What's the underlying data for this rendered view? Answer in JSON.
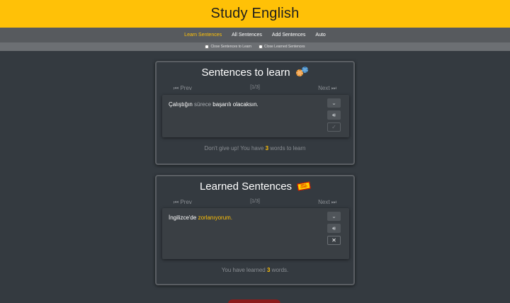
{
  "app": {
    "title": "Study English"
  },
  "nav": {
    "items": [
      {
        "label": "Learn Sentences",
        "active": true
      },
      {
        "label": "All Sentences"
      },
      {
        "label": "Add Sentences"
      },
      {
        "label": "Auto"
      }
    ]
  },
  "filters": {
    "close_to_learn": "Close Sentences to Learn",
    "close_learned": "Close Learned Sentences"
  },
  "learn_panel": {
    "title": "Sentences to learn",
    "prev": "Prev",
    "next": "Next",
    "counter": "[1/3]",
    "sentence": {
      "part1": "Çalıştığın",
      "part2": "sürece",
      "part3": "başarılı olacaksın."
    },
    "footer": {
      "before": "Don't give up! You have",
      "count": "3",
      "after": "words to learn"
    }
  },
  "learned_panel": {
    "title": "Learned Sentences",
    "badge_line1": "WELL",
    "badge_line2": "DONE!",
    "prev": "Prev",
    "next": "Next",
    "counter": "[1/3]",
    "sentence": {
      "part1": "İngilizce'de",
      "part2": "zorlanıyorum."
    },
    "footer": {
      "before": "You have learned",
      "count": "3",
      "after": "words."
    }
  },
  "icons": {
    "expand": "chevron-down-icon",
    "audio": "speaker-icon",
    "learned": "check-icon",
    "remove": "close-icon"
  },
  "colors": {
    "accent": "#ffc107",
    "background": "#343a40"
  }
}
